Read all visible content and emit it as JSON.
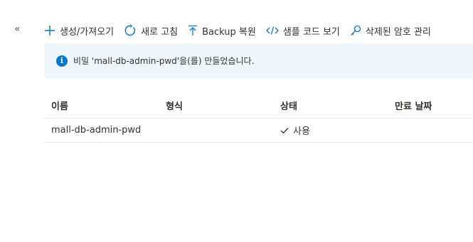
{
  "collapse_glyph": "«",
  "toolbar": {
    "items": [
      {
        "label": "생성/가져오기",
        "icon": "plus-icon"
      },
      {
        "label": "새로 고침",
        "icon": "refresh-icon"
      },
      {
        "label": "Backup 복원",
        "icon": "upload-icon"
      },
      {
        "label": "샘플 코드 보기",
        "icon": "code-icon"
      },
      {
        "label": "삭제된 암호 관리",
        "icon": "key-icon"
      }
    ]
  },
  "info": {
    "icon_glyph": "i",
    "message": "비밀 'mall-db-admin-pwd'을(를) 만들었습니다."
  },
  "table": {
    "headers": [
      "이름",
      "형식",
      "상태",
      "만료 날짜"
    ],
    "rows": [
      {
        "name": "mall-db-admin-pwd",
        "type": "",
        "status": "사용",
        "expires": ""
      }
    ]
  },
  "colors": {
    "accent": "#0078d4",
    "info_bg": "#eff6fc"
  }
}
